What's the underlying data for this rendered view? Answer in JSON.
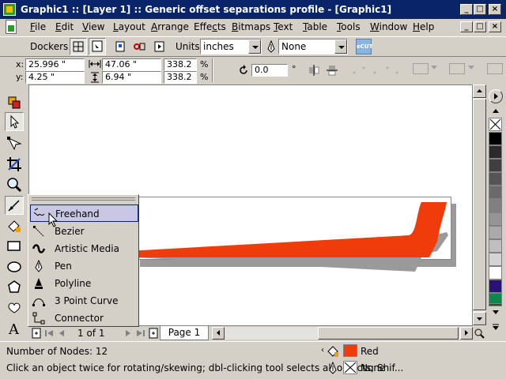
{
  "window": {
    "title": "Graphic1 :: [Layer 1] :: Generic offset separations profile - [Graphic1]",
    "min_glyph": "_",
    "max_glyph": "□",
    "close_glyph": "×"
  },
  "menu": [
    "File",
    "Edit",
    "View",
    "Layout",
    "Arrange",
    "Effects",
    "Bitmaps",
    "Text",
    "Table",
    "Tools",
    "Window",
    "Help"
  ],
  "menu_underline_index": [
    0,
    0,
    0,
    0,
    0,
    4,
    0,
    0,
    0,
    0,
    0,
    0
  ],
  "toolbar": {
    "dockers_label": "Dockers",
    "units_label": "Units:",
    "units_value": "inches",
    "outline_value": "None",
    "ecut_label": "eCUT"
  },
  "propbar": {
    "x_label": "x:",
    "x_value": "25.996 \"",
    "y_label": "y:",
    "y_value": "4.25 \"",
    "w_value": "47.06 \"",
    "h_value": "6.94 \"",
    "scale_w": "338.2",
    "scale_h": "338.2",
    "pct": "%",
    "rotation": "0.0",
    "degree": "°"
  },
  "flyout": {
    "items": [
      {
        "label": "Freehand",
        "icon": "freehand-icon",
        "underline": "F"
      },
      {
        "label": "Bezier",
        "icon": "bezier-icon",
        "underline": "B"
      },
      {
        "label": "Artistic Media",
        "icon": "artistic-media-icon",
        "underline": ""
      },
      {
        "label": "Pen",
        "icon": "pen-icon",
        "underline": "P"
      },
      {
        "label": "Polyline",
        "icon": "polyline-icon",
        "underline": "P"
      },
      {
        "label": "3 Point Curve",
        "icon": "three-point-curve-icon",
        "underline": "3"
      },
      {
        "label": "Connector",
        "icon": "connector-icon",
        "underline": "C"
      }
    ]
  },
  "pages": {
    "counter": "1 of 1",
    "tab": "Page 1"
  },
  "status": {
    "nodes": "Number of Nodes: 12",
    "hint": "Click an object twice for rotating/skewing; dbl-clicking tool selects all objects; Shif...",
    "fill_name": "Red",
    "fill_color": "#f03c0a",
    "outline_name": "None"
  },
  "palette": [
    "#ffffff",
    "#000000",
    "#2a2a2a",
    "#3f3f3f",
    "#555555",
    "#6a6a6a",
    "#808080",
    "#959595",
    "#aaaaaa",
    "#bfbfbf",
    "#d4d4d4",
    "#ffffff",
    "#2a1178",
    "#1e5a1e",
    "#0a8a4a"
  ],
  "colors": {
    "shape_fill": "#f03c0a",
    "titlebar": "#0a246a"
  }
}
